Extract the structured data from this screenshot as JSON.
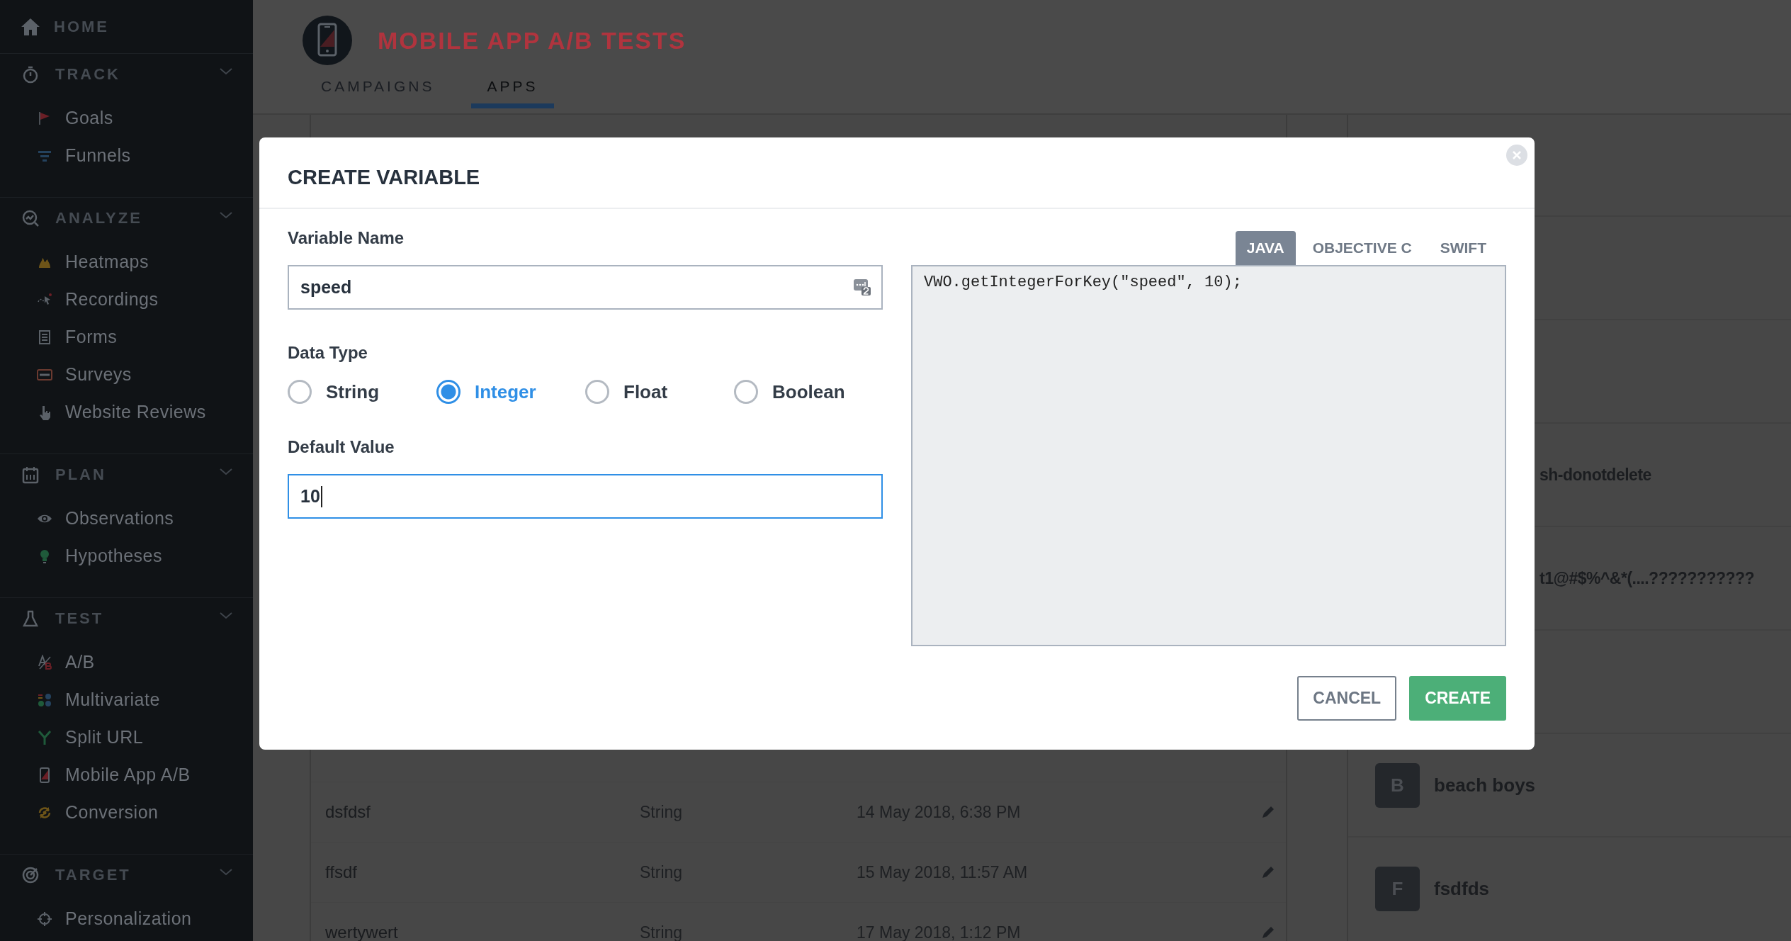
{
  "sidebar": {
    "home": {
      "label": "HOME"
    },
    "sections": [
      {
        "label": "TRACK",
        "expanded": true,
        "items": [
          "Goals",
          "Funnels"
        ]
      },
      {
        "label": "ANALYZE",
        "expanded": true,
        "items": [
          "Heatmaps",
          "Recordings",
          "Forms",
          "Surveys",
          "Website Reviews"
        ]
      },
      {
        "label": "PLAN",
        "expanded": true,
        "items": [
          "Observations",
          "Hypotheses"
        ]
      },
      {
        "label": "TEST",
        "expanded": true,
        "items": [
          "A/B",
          "Multivariate",
          "Split URL",
          "Mobile App A/B",
          "Conversion"
        ]
      },
      {
        "label": "TARGET",
        "expanded": true,
        "items": [
          "Personalization"
        ]
      }
    ]
  },
  "page": {
    "title": "MOBILE APP A/B TESTS",
    "tabs": [
      {
        "label": "CAMPAIGNS",
        "selected": false
      },
      {
        "label": "APPS",
        "selected": true
      }
    ]
  },
  "variables_table": {
    "rows": [
      {
        "name": "dsfdsf",
        "type": "String",
        "date": "14 May 2018, 6:38 PM"
      },
      {
        "name": "ffsdf",
        "type": "String",
        "date": "15 May 2018, 11:57 AM"
      },
      {
        "name": "wertywert",
        "type": "String",
        "date": "17 May 2018, 1:12 PM"
      }
    ]
  },
  "apps_list": {
    "items": [
      {
        "name": "sh-donotdelete"
      },
      {
        "name": "t1@#$%^&*(....???????????"
      },
      {
        "avatar": "B",
        "name": "beach boys"
      },
      {
        "avatar": "F",
        "name": "fsdfds"
      }
    ]
  },
  "modal": {
    "title": "CREATE VARIABLE",
    "variable_name": {
      "label": "Variable Name",
      "value": "speed"
    },
    "data_type": {
      "label": "Data Type",
      "options": [
        {
          "label": "String",
          "selected": false
        },
        {
          "label": "Integer",
          "selected": true
        },
        {
          "label": "Float",
          "selected": false
        },
        {
          "label": "Boolean",
          "selected": false
        }
      ]
    },
    "default_value": {
      "label": "Default Value",
      "value": "10",
      "focused": true
    },
    "code_tabs": [
      {
        "label": "JAVA",
        "selected": true
      },
      {
        "label": "OBJECTIVE C",
        "selected": false
      },
      {
        "label": "SWIFT",
        "selected": false
      }
    ],
    "code": "VWO.getIntegerForKey(\"speed\", 10);",
    "buttons": [
      {
        "label": "CANCEL",
        "kind": "secondary"
      },
      {
        "label": "CREATE",
        "kind": "primary"
      }
    ]
  }
}
